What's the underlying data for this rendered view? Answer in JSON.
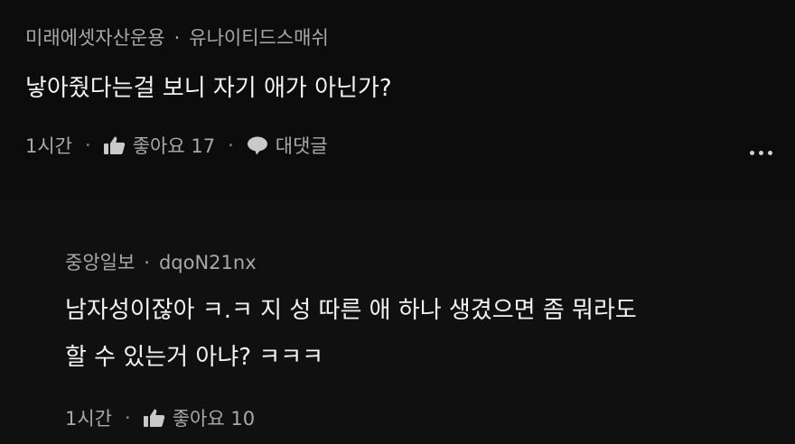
{
  "comments": [
    {
      "source": "미래에셋자산운용",
      "separator": "·",
      "author": "유나이티드스매쉬",
      "text": "낳아줬다는걸 보니 자기 애가 아닌가?",
      "time": "1시간",
      "like_label": "좋아요 17",
      "reply_label": "대댓글"
    },
    {
      "source": "중앙일보",
      "separator": "·",
      "author": "dqoN21nx",
      "text_line1": "남자성이잖아 ㅋ.ㅋ 지 성 따른 애 하나 생겼으면 좀 뭐라도",
      "text_line2": "할 수 있는거 아냐? ㅋㅋㅋ",
      "time": "1시간",
      "like_label": "좋아요 10"
    }
  ],
  "action_separator": "·",
  "icons": {
    "like": "thumbs-up-icon",
    "reply": "speech-bubble-icon",
    "more": "more-horizontal-icon"
  },
  "colors": {
    "background": "#0c0c0d",
    "reply_background": "#101011",
    "text": "#f3f3f3",
    "muted": "#a8a8a8"
  }
}
